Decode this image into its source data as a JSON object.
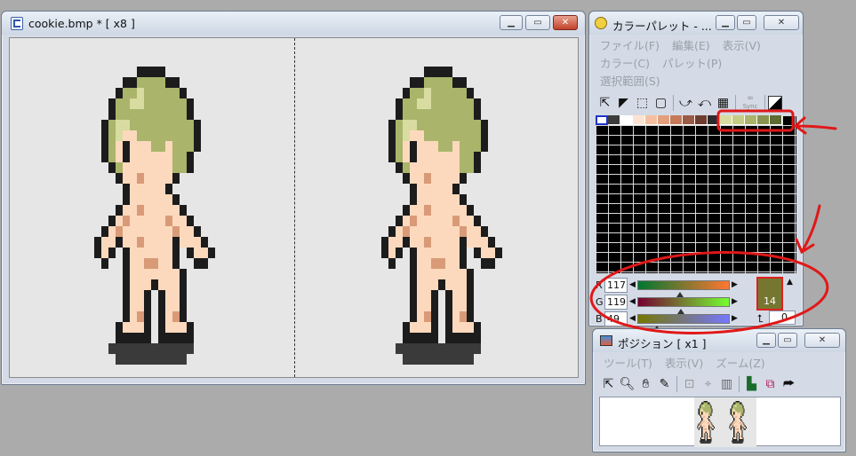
{
  "editor": {
    "title": "cookie.bmp * [ x8 ]",
    "icon": "document-icon"
  },
  "palette_window": {
    "title": "カラーパレット - ...",
    "menus": [
      "ファイル(F)",
      "編集(E)",
      "表示(V)",
      "カラー(C)",
      "パレット(P)",
      "選択範囲(S)"
    ],
    "tools": [
      "select-arrow-icon",
      "select-fill-icon",
      "rect-select-dashed-icon",
      "rect-select-icon",
      "copy-swap-icon",
      "swap-icon",
      "grid-icon",
      "sync-icon",
      "mask-icon"
    ],
    "sync_label": "Sync",
    "swatches": [
      "#ffffff",
      "#3c3c3c",
      "#ffffff",
      "#fde3cf",
      "#f4c0a1",
      "#e2a07d",
      "#c57a5a",
      "#9b5b45",
      "#6f3d2f",
      "#2b2b2b",
      "#d8dca0",
      "#c6cc84",
      "#aab46a",
      "#8a9450",
      "#5e6b32"
    ],
    "rgb": {
      "r": "117",
      "g": "119",
      "b": "49"
    },
    "channel_labels": {
      "r": "R",
      "g": "G",
      "b": "B"
    },
    "selected_color": "#757731",
    "selected_index": "14",
    "preview_value": "0"
  },
  "position_window": {
    "title": "ポジション [ x1 ]",
    "menus": [
      "ツール(T)",
      "表示(V)",
      "ズーム(Z)"
    ],
    "tools": [
      "arrow-icon",
      "zoom-icon",
      "hand-icon",
      "pen-icon",
      "zoom-box-icon",
      "crosshair-icon",
      "panel-icon",
      "image-icon",
      "copy-icon",
      "export-icon"
    ]
  },
  "annotations_color": "#e01818"
}
